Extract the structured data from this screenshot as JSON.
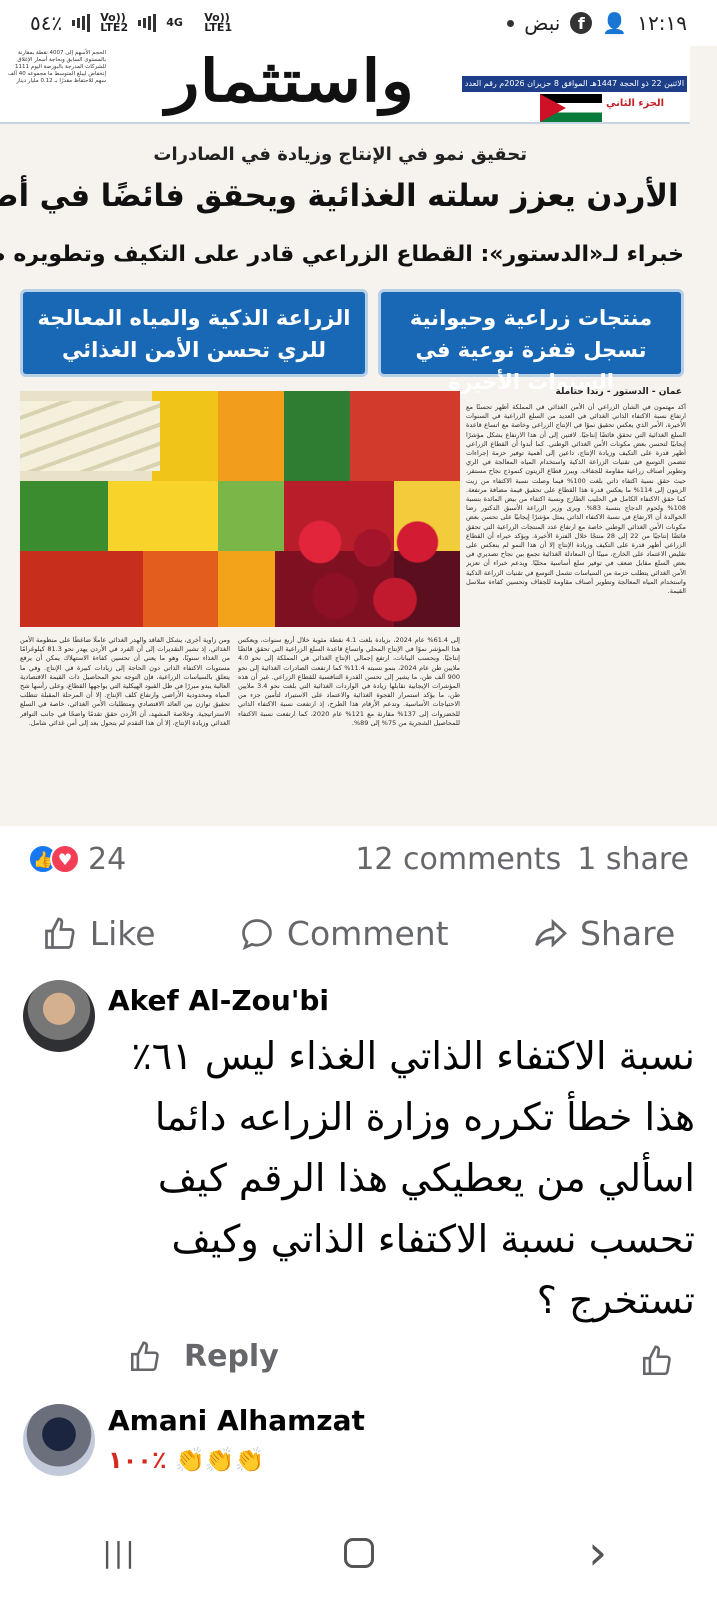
{
  "status_bar": {
    "time": "١٢:١٩",
    "app_label": "نبض",
    "battery": "٥٤٪",
    "network_1": "Vo)) LTE1",
    "network_2": "4G",
    "network_3": "Vo)) LTE2"
  },
  "newspaper": {
    "masthead": "واستثمار",
    "date_strip": "الاثنين 22 ذو الحجة 1447هـ الموافق 8 حزيران 2026م  رقم العدد 21115",
    "part": "الجزء الثاني",
    "kicker": "تحقيق نمو في الإنتاج وزيادة في الصادرات",
    "headline": "الأردن يعزز سلته الغذائية ويحقق فائضًا في أصناف عديدة",
    "subheadline": "خبراء لـ«الدستور»: القطاع الزراعي قادر على التكيف وتطويره ضرورة",
    "box_right": "منتجات زراعية وحيوانية تسجل قفزة نوعية في السنوات الأخيرة",
    "box_left": "الزراعة الذكية والمياه المعالجة للري تحسن الأمن الغذائي",
    "byline": "عمان - الدستور - رندا حتاملة",
    "body_main": "أكد مهتمون في الشأن الزراعي أن الأمن الغذائي في المملكة أظهر تحسنًا مع ارتفاع نسبة الاكتفاء الذاتي الغذائي في العديد من السلع الزراعية في السنوات الأخيرة، الأمر الذي يعكس تحقيق نموًا في الإنتاج الزراعي وخاصة مع اتساع قاعدة السلع الغذائية التي تحقق فائضًا إنتاجيًا. لافتين إلى أن هذا الارتفاع يشكل مؤشرًا إيجابيًا لتحسن بعض مكونات الأمن الغذائي الوطني. كما أبدوا أن القطاع الزراعي أظهر قدرة على التكيف وزيادة الإنتاج، داعين إلى أهمية توفير حزمة إجراءات تتضمن التوسع في تقنيات الزراعة الذكية واستخدام المياه المعالجة في الري وتطوير أصناف زراعية مقاومة للجفاف. ويبرز قطاع الزيتون كنموذج نجاح مستقر، حيث حقق نسبة اكتفاء ذاتي بلغت 100% فيما وصلت نسبة الاكتفاء من زيت الزيتون إلى 114% ما يعكس قدرة هذا القطاع على تحقيق قيمة مضافة مرتفعة. كما حقق الاكتفاء الكامل في الحليب الطازج ونسبة اكتفاء من بيض المائدة بنسبة 108% ولحوم الدجاج بنسبة 83%. ويرى وزير الزراعة الأسبق الدكتور رضا الخوالدة أن الارتفاع في نسبة الاكتفاء الذاتي يمثل مؤشرًا إيجابيًا على تحسن بعض مكونات الأمن الغذائي الوطني خاصة مع ارتفاع عدد المنتجات الزراعية التي تحقق فائضًا إنتاجيًا من 22 إلى 28 منتجًا خلال الفترة الأخيرة. ويؤكد خبراء أن القطاع الزراعي أظهر قدرة على التكيف وزيادة الإنتاج إلا أن هذا النمو لم ينعكس على تقليص الاعتماد على الخارج، مبينًا أن المعادلة الغذائية تجمع بين نجاح تصديري في بعض السلع مقابل ضعف في توفير سلع أساسية محليًا. ويدعم خبراء أن تعزيز الأمن الغذائي يتطلب حزمة من السياسات تشمل التوسع في تقنيات الزراعة الذكية واستخدام المياه المعالجة وتطوير أصناف مقاومة للجفاف وتحسين كفاءة سلاسل القيمة.",
    "body_col1": "إلى 61.4% عام 2024، بزيادة بلغت 4.1 نقطة مئوية خلال أربع سنوات، ويعكس هذا المؤشر نموًا في الإنتاج المحلي واتساع قاعدة السلع الزراعية التي تحقق فائضًا إنتاجيًا. وبحسب البيانات، ارتفع إجمالي الإنتاج الغذائي في المملكة إلى نحو 4.0 ملايين طن عام 2024، بنمو نسبته 11.4% كما ارتفعت الصادرات الغذائية إلى نحو 900 ألف طن، ما يشير إلى تحسن القدرة التنافسية للقطاع الزراعي. غير أن هذه المؤشرات الإيجابية تقابلها زيادة في الواردات الغذائية التي بلغت نحو 3.4 ملايين طن، ما يؤكد استمرار الفجوة الغذائية والاعتماد على الاستيراد لتأمين جزء من الاحتياجات الأساسية. وتدعم الأرقام هذا الطرح، إذ ارتفعت نسبة الاكتفاء الذاتي للخضروات إلى 137% مقارنة مع 121% عام 2020، كما ارتفعت نسبة الاكتفاء للمحاصيل الشجرية من 75% إلى 89%.",
    "body_col2": "ومن زاوية أخرى، يشكل الفاقد والهدر الغذائي عاملًا ضاغطًا على منظومة الأمن الغذائي، إذ تشير التقديرات إلى أن الفرد في الأردن يهدر نحو 81.3 كيلوغرامًا من الغذاء سنويًا، وهو ما يعني أن تحسين كفاءة الاستهلاك يمكن أن يرفع مستويات الاكتفاء الذاتي دون الحاجة إلى زيادات كبيرة في الإنتاج. وفي ما يتعلق بالسياسات الزراعية، فإن التوجه نحو المحاصيل ذات القيمة الاقتصادية العالية يبدو مبررًا في ظل القيود الهيكلية التي يواجهها القطاع، وعلى رأسها شح المياه ومحدودية الأراضي وارتفاع كلف الإنتاج. إلا أن المرحلة المقبلة تتطلب تحقيق توازن بين العائد الاقتصادي ومتطلبات الأمن الغذائي، خاصة في السلع الاستراتيجية. وخلاصة المشهد، أن الأردن حقق تقدمًا واضحًا في جانب التوافر الغذائي وزيادة الإنتاج، إلا أن هذا التقدم لم يتحول بعد إلى أمن غذائي شامل.",
    "mast_note": "الحجم الأسهم إلى 4007 نقطة بمقارنة بالمستوى السابق وبحاجة أسعار الإغلاق للشركات المدرجة بالبورصة اليوم 1111 إنخفاض ليبلغ المتوسط ما مجموعه 40 ألف سهم للاحتفاظ مقدرًا بـ 0.12 مليار دينار"
  },
  "post": {
    "reactions_count": "24",
    "comments": "12 comments",
    "shares": "1 share",
    "actions": {
      "like": "Like",
      "comment": "Comment",
      "share": "Share"
    }
  },
  "comments": [
    {
      "author": "Akef Al-Zou'bi",
      "text": "نسبة الاكتفاء الذاتي الغذاء ليس ٦١٪ هذا خطأ تكرره وزارة الزراعه دائما اسألي من يعطيكي هذا الرقم كيف تحسب نسبة الاكتفاء الذاتي وكيف تستخرج ؟",
      "reply": "Reply"
    },
    {
      "author": "Amani Alhamzat",
      "text_prefix": "١٠٠٪",
      "text_icons": "👏👏👏"
    }
  ],
  "nav": {
    "recents": "|||",
    "home": "○",
    "back": "‹"
  },
  "colors": {
    "facebook_blue": "#1877f2",
    "love_red": "#f33e58",
    "box_blue": "#1968b5",
    "brand_red": "#d72126"
  }
}
